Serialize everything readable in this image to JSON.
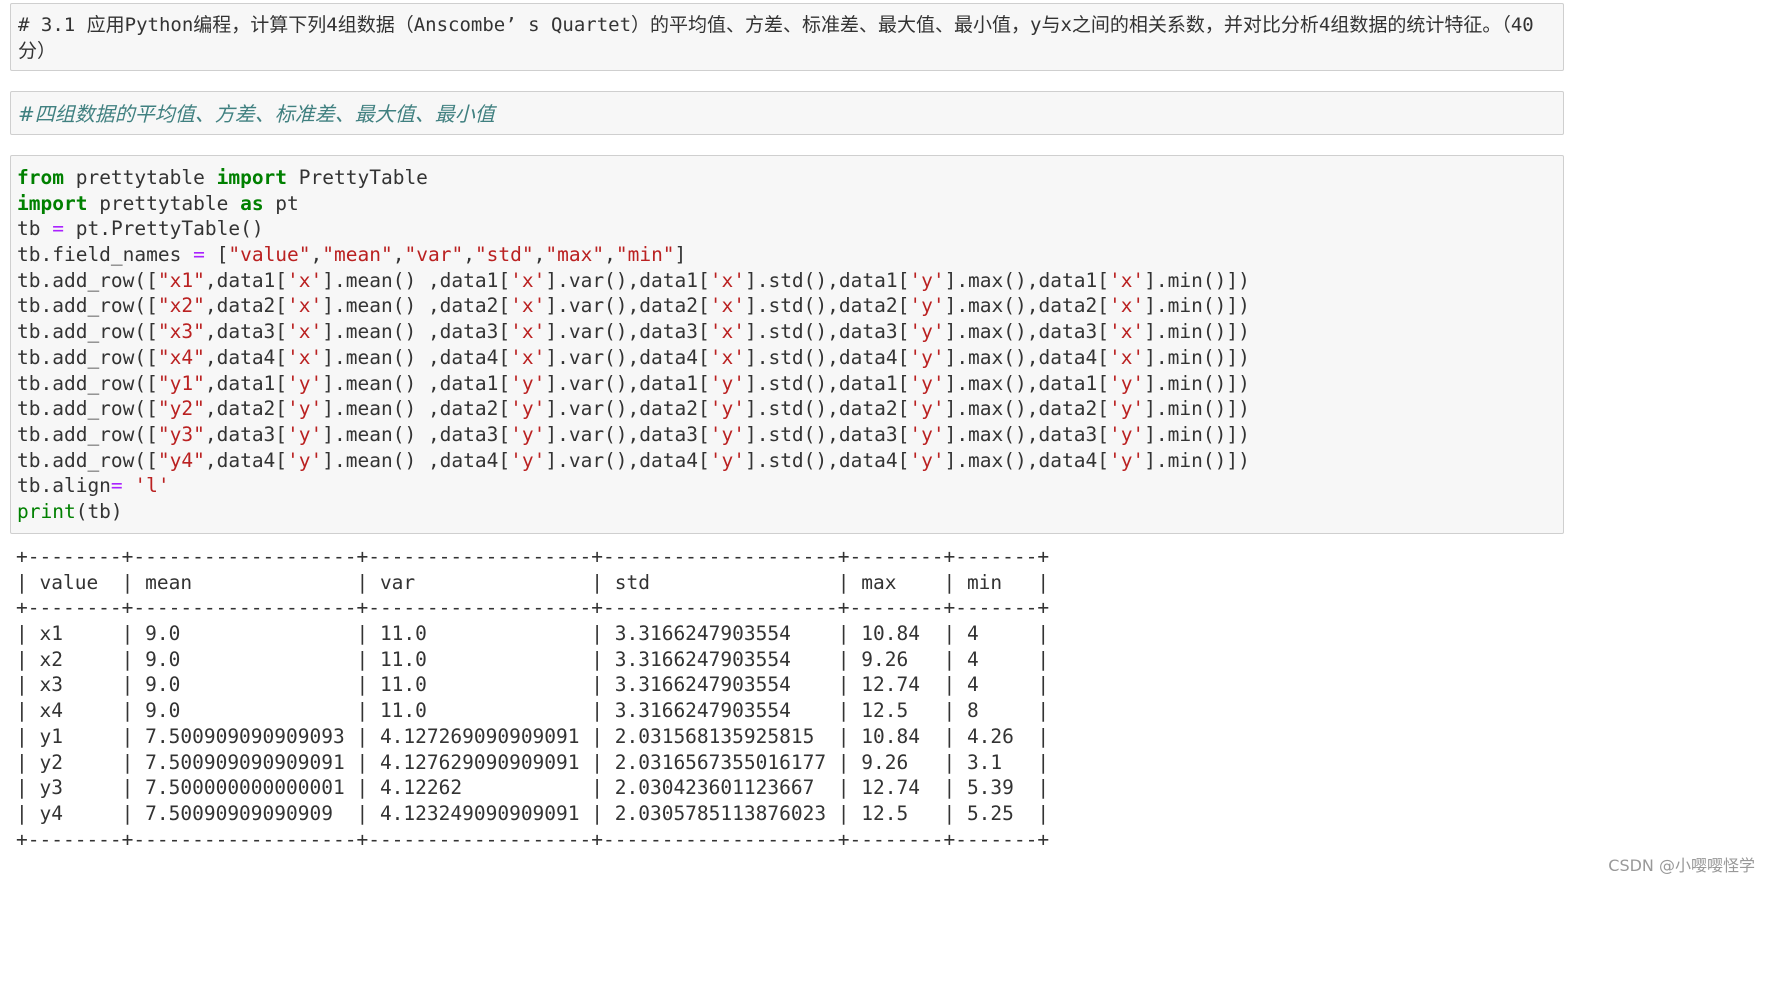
{
  "markdown_cell_1": {
    "text": "# 3.1 应用Python编程，计算下列4组数据（Anscombe’ s Quartet）的平均值、方差、标准差、最大值、最小值，y与x之间的相关系数，并对比分析4组数据的统计特征。（40分）"
  },
  "markdown_cell_2": {
    "text": "#四组数据的平均值、方差、标准差、最大值、最小值"
  },
  "code_cell": {
    "lines": [
      {
        "segments": [
          {
            "t": "from",
            "c": "kw"
          },
          {
            "t": " prettytable ",
            "c": ""
          },
          {
            "t": "import",
            "c": "kw"
          },
          {
            "t": " PrettyTable",
            "c": ""
          }
        ]
      },
      {
        "segments": [
          {
            "t": "import",
            "c": "kw"
          },
          {
            "t": " prettytable ",
            "c": ""
          },
          {
            "t": "as",
            "c": "kw"
          },
          {
            "t": " pt",
            "c": ""
          }
        ]
      },
      {
        "segments": [
          {
            "t": "tb ",
            "c": ""
          },
          {
            "t": "=",
            "c": "op"
          },
          {
            "t": " pt.PrettyTable()",
            "c": ""
          }
        ]
      },
      {
        "segments": [
          {
            "t": "tb.field_names ",
            "c": ""
          },
          {
            "t": "=",
            "c": "op"
          },
          {
            "t": " [",
            "c": ""
          },
          {
            "t": "\"value\"",
            "c": "str"
          },
          {
            "t": ",",
            "c": ""
          },
          {
            "t": "\"mean\"",
            "c": "str"
          },
          {
            "t": ",",
            "c": ""
          },
          {
            "t": "\"var\"",
            "c": "str"
          },
          {
            "t": ",",
            "c": ""
          },
          {
            "t": "\"std\"",
            "c": "str"
          },
          {
            "t": ",",
            "c": ""
          },
          {
            "t": "\"max\"",
            "c": "str"
          },
          {
            "t": ",",
            "c": ""
          },
          {
            "t": "\"min\"",
            "c": "str"
          },
          {
            "t": "]",
            "c": ""
          }
        ]
      },
      {
        "segments": [
          {
            "t": "tb.add_row([",
            "c": ""
          },
          {
            "t": "\"x1\"",
            "c": "str"
          },
          {
            "t": ",data1[",
            "c": ""
          },
          {
            "t": "'x'",
            "c": "str"
          },
          {
            "t": "].mean() ,data1[",
            "c": ""
          },
          {
            "t": "'x'",
            "c": "str"
          },
          {
            "t": "].var(),data1[",
            "c": ""
          },
          {
            "t": "'x'",
            "c": "str"
          },
          {
            "t": "].std(),data1[",
            "c": ""
          },
          {
            "t": "'y'",
            "c": "str"
          },
          {
            "t": "].max(),data1[",
            "c": ""
          },
          {
            "t": "'x'",
            "c": "str"
          },
          {
            "t": "].min()])",
            "c": ""
          }
        ]
      },
      {
        "segments": [
          {
            "t": "tb.add_row([",
            "c": ""
          },
          {
            "t": "\"x2\"",
            "c": "str"
          },
          {
            "t": ",data2[",
            "c": ""
          },
          {
            "t": "'x'",
            "c": "str"
          },
          {
            "t": "].mean() ,data2[",
            "c": ""
          },
          {
            "t": "'x'",
            "c": "str"
          },
          {
            "t": "].var(),data2[",
            "c": ""
          },
          {
            "t": "'x'",
            "c": "str"
          },
          {
            "t": "].std(),data2[",
            "c": ""
          },
          {
            "t": "'y'",
            "c": "str"
          },
          {
            "t": "].max(),data2[",
            "c": ""
          },
          {
            "t": "'x'",
            "c": "str"
          },
          {
            "t": "].min()])",
            "c": ""
          }
        ]
      },
      {
        "segments": [
          {
            "t": "tb.add_row([",
            "c": ""
          },
          {
            "t": "\"x3\"",
            "c": "str"
          },
          {
            "t": ",data3[",
            "c": ""
          },
          {
            "t": "'x'",
            "c": "str"
          },
          {
            "t": "].mean() ,data3[",
            "c": ""
          },
          {
            "t": "'x'",
            "c": "str"
          },
          {
            "t": "].var(),data3[",
            "c": ""
          },
          {
            "t": "'x'",
            "c": "str"
          },
          {
            "t": "].std(),data3[",
            "c": ""
          },
          {
            "t": "'y'",
            "c": "str"
          },
          {
            "t": "].max(),data3[",
            "c": ""
          },
          {
            "t": "'x'",
            "c": "str"
          },
          {
            "t": "].min()])",
            "c": ""
          }
        ]
      },
      {
        "segments": [
          {
            "t": "tb.add_row([",
            "c": ""
          },
          {
            "t": "\"x4\"",
            "c": "str"
          },
          {
            "t": ",data4[",
            "c": ""
          },
          {
            "t": "'x'",
            "c": "str"
          },
          {
            "t": "].mean() ,data4[",
            "c": ""
          },
          {
            "t": "'x'",
            "c": "str"
          },
          {
            "t": "].var(),data4[",
            "c": ""
          },
          {
            "t": "'x'",
            "c": "str"
          },
          {
            "t": "].std(),data4[",
            "c": ""
          },
          {
            "t": "'y'",
            "c": "str"
          },
          {
            "t": "].max(),data4[",
            "c": ""
          },
          {
            "t": "'x'",
            "c": "str"
          },
          {
            "t": "].min()])",
            "c": ""
          }
        ]
      },
      {
        "segments": [
          {
            "t": "tb.add_row([",
            "c": ""
          },
          {
            "t": "\"y1\"",
            "c": "str"
          },
          {
            "t": ",data1[",
            "c": ""
          },
          {
            "t": "'y'",
            "c": "str"
          },
          {
            "t": "].mean() ,data1[",
            "c": ""
          },
          {
            "t": "'y'",
            "c": "str"
          },
          {
            "t": "].var(),data1[",
            "c": ""
          },
          {
            "t": "'y'",
            "c": "str"
          },
          {
            "t": "].std(),data1[",
            "c": ""
          },
          {
            "t": "'y'",
            "c": "str"
          },
          {
            "t": "].max(),data1[",
            "c": ""
          },
          {
            "t": "'y'",
            "c": "str"
          },
          {
            "t": "].min()])",
            "c": ""
          }
        ]
      },
      {
        "segments": [
          {
            "t": "tb.add_row([",
            "c": ""
          },
          {
            "t": "\"y2\"",
            "c": "str"
          },
          {
            "t": ",data2[",
            "c": ""
          },
          {
            "t": "'y'",
            "c": "str"
          },
          {
            "t": "].mean() ,data2[",
            "c": ""
          },
          {
            "t": "'y'",
            "c": "str"
          },
          {
            "t": "].var(),data2[",
            "c": ""
          },
          {
            "t": "'y'",
            "c": "str"
          },
          {
            "t": "].std(),data2[",
            "c": ""
          },
          {
            "t": "'y'",
            "c": "str"
          },
          {
            "t": "].max(),data2[",
            "c": ""
          },
          {
            "t": "'y'",
            "c": "str"
          },
          {
            "t": "].min()])",
            "c": ""
          }
        ]
      },
      {
        "segments": [
          {
            "t": "tb.add_row([",
            "c": ""
          },
          {
            "t": "\"y3\"",
            "c": "str"
          },
          {
            "t": ",data3[",
            "c": ""
          },
          {
            "t": "'y'",
            "c": "str"
          },
          {
            "t": "].mean() ,data3[",
            "c": ""
          },
          {
            "t": "'y'",
            "c": "str"
          },
          {
            "t": "].var(),data3[",
            "c": ""
          },
          {
            "t": "'y'",
            "c": "str"
          },
          {
            "t": "].std(),data3[",
            "c": ""
          },
          {
            "t": "'y'",
            "c": "str"
          },
          {
            "t": "].max(),data3[",
            "c": ""
          },
          {
            "t": "'y'",
            "c": "str"
          },
          {
            "t": "].min()])",
            "c": ""
          }
        ]
      },
      {
        "segments": [
          {
            "t": "tb.add_row([",
            "c": ""
          },
          {
            "t": "\"y4\"",
            "c": "str"
          },
          {
            "t": ",data4[",
            "c": ""
          },
          {
            "t": "'y'",
            "c": "str"
          },
          {
            "t": "].mean() ,data4[",
            "c": ""
          },
          {
            "t": "'y'",
            "c": "str"
          },
          {
            "t": "].var(),data4[",
            "c": ""
          },
          {
            "t": "'y'",
            "c": "str"
          },
          {
            "t": "].std(),data4[",
            "c": ""
          },
          {
            "t": "'y'",
            "c": "str"
          },
          {
            "t": "].max(),data4[",
            "c": ""
          },
          {
            "t": "'y'",
            "c": "str"
          },
          {
            "t": "].min()])",
            "c": ""
          }
        ]
      },
      {
        "segments": [
          {
            "t": "tb.align",
            "c": ""
          },
          {
            "t": "=",
            "c": "op"
          },
          {
            "t": " ",
            "c": ""
          },
          {
            "t": "'l'",
            "c": "str"
          }
        ]
      },
      {
        "segments": [
          {
            "t": "print",
            "c": "fn"
          },
          {
            "t": "(tb)",
            "c": ""
          }
        ]
      }
    ]
  },
  "output_table": {
    "border": "+--------+-------------------+-------------------+--------------------+--------+-------+",
    "header": "| value  | mean              | var               | std                | max    | min   |",
    "rows": [
      "| x1     | 9.0               | 11.0              | 3.3166247903554    | 10.84  | 4     |",
      "| x2     | 9.0               | 11.0              | 3.3166247903554    | 9.26   | 4     |",
      "| x3     | 9.0               | 11.0              | 3.3166247903554    | 12.74  | 4     |",
      "| x4     | 9.0               | 11.0              | 3.3166247903554    | 12.5   | 8     |",
      "| y1     | 7.500909090909093 | 4.127269090909091 | 2.031568135925815  | 10.84  | 4.26  |",
      "| y2     | 7.500909090909091 | 4.127629090909091 | 2.0316567355016177 | 9.26   | 3.1   |",
      "| y3     | 7.500000000000001 | 4.12262           | 2.030423601123667  | 12.74  | 5.39  |",
      "| y4     | 7.50090909090909  | 4.123249090909091 | 2.0305785113876023 | 12.5   | 5.25  |"
    ]
  },
  "watermark": {
    "text": "CSDN @小嘤嘤怪学"
  }
}
